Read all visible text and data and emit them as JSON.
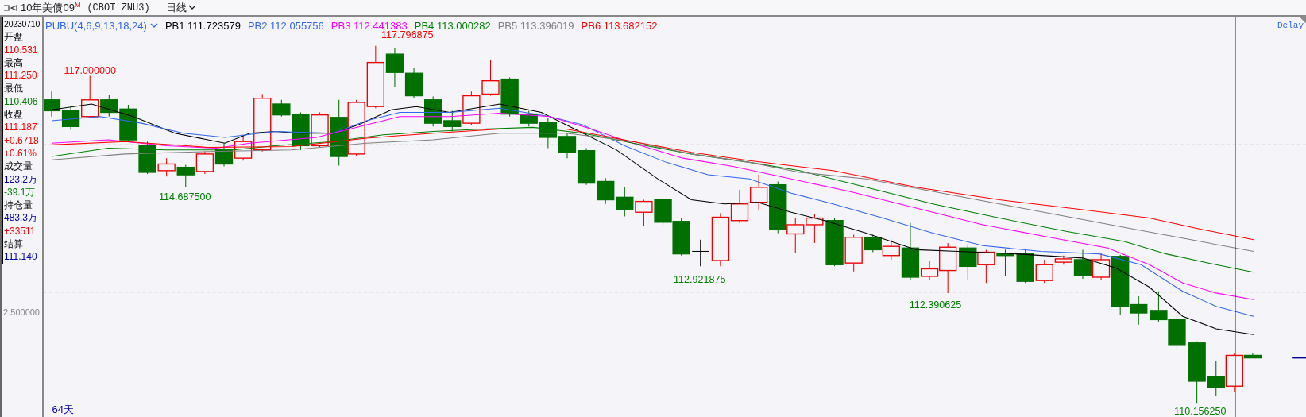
{
  "toolbar": {
    "title": "10年美债09$^{M}$",
    "symbol": "(CBOT ZNU3)",
    "period": "日线"
  },
  "info_panel": {
    "date": "20230710",
    "rows": [
      {
        "kind": "label",
        "text": "开盘"
      },
      {
        "kind": "value",
        "text": "110.531",
        "color": "#ff0000"
      },
      {
        "kind": "label",
        "text": "最高"
      },
      {
        "kind": "value",
        "text": "111.250",
        "color": "#ff0000"
      },
      {
        "kind": "label",
        "text": "最低"
      },
      {
        "kind": "value",
        "text": "110.406",
        "color": "#008000"
      },
      {
        "kind": "label",
        "text": "收盘"
      },
      {
        "kind": "value",
        "text": "111.187",
        "color": "#ff0000"
      },
      {
        "kind": "value",
        "text": "+0.6718",
        "color": "#ff0000"
      },
      {
        "kind": "value",
        "text": "+0.61%",
        "color": "#ff0000"
      },
      {
        "kind": "label",
        "text": "成交量"
      },
      {
        "kind": "value",
        "text": "123.2万",
        "color": "#0000a0"
      },
      {
        "kind": "value",
        "text": "-39.1万",
        "color": "#008000"
      },
      {
        "kind": "label",
        "text": "持仓量"
      },
      {
        "kind": "value",
        "text": "483.3万",
        "color": "#0000a0"
      },
      {
        "kind": "value",
        "text": "+33511",
        "color": "#ff0000"
      },
      {
        "kind": "label",
        "text": "结算"
      },
      {
        "kind": "value",
        "text": "111.140",
        "color": "#0000a0"
      }
    ]
  },
  "price_axis": {
    "tick_label": "2.500000"
  },
  "indicator": {
    "name": "PUBU(4,6,9,13,18,24)",
    "legend": [
      {
        "label": "PB1",
        "value": "111.723579",
        "color": "#000000"
      },
      {
        "label": "PB2",
        "value": "112.055756",
        "color": "#3366ee"
      },
      {
        "label": "PB3",
        "value": "112.441383",
        "color": "#ff00ff"
      },
      {
        "label": "PB4",
        "value": "113.000282",
        "color": "#008000"
      },
      {
        "label": "PB5",
        "value": "113.396019",
        "color": "#808080"
      },
      {
        "label": "PB6",
        "value": "113.682152",
        "color": "#ff0000"
      }
    ]
  },
  "status": "Delay",
  "price_labels": [
    {
      "kind": "high",
      "text": "117.000000"
    },
    {
      "kind": "high",
      "text": "117.796875"
    },
    {
      "kind": "low",
      "text": "114.687500"
    },
    {
      "kind": "low",
      "text": "112.921875"
    },
    {
      "kind": "low",
      "text": "112.390625"
    },
    {
      "kind": "low",
      "text": "110.156250"
    }
  ],
  "day_count": "64天"
}
